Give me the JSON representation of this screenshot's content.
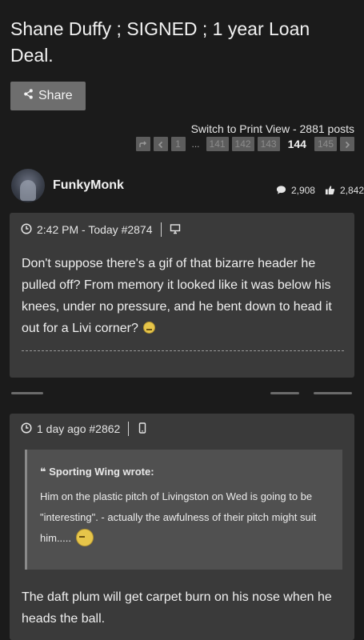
{
  "thread": {
    "title": "Shane Duffy ; SIGNED ; 1 year Loan Deal.",
    "share_label": "Share",
    "print_view": "Switch to Print View - 2881 posts"
  },
  "pagination": {
    "first": "1",
    "ellipsis": "...",
    "pages": [
      "141",
      "142",
      "143"
    ],
    "current": "144",
    "next_page": "145"
  },
  "post1": {
    "username": "FunkyMonk",
    "comments_count": "2,908",
    "likes_count": "2,842",
    "timestamp": "2:42 PM - Today #2874",
    "body": "Don't suppose there's a gif of that bizarre header he pulled off? From memory it looked like it was below his knees, under no pressure, and he bent down to head it out for a Livi corner?",
    "device_icon": "desktop-icon"
  },
  "post2": {
    "timestamp": "1 day ago #2862",
    "device_icon": "mobile-icon",
    "quote_author": "Sporting Wing wrote:",
    "quote_text": "Him on the plastic pitch of Livingston on Wed is going to be \"interesting\". - actually the awfulness of their pitch might suit him.....",
    "body": "The daft plum will get carpet burn on his nose when he heads the ball."
  },
  "colors": {
    "background": "#1b1b1b",
    "card": "#3a3a3a",
    "quote_bg": "#505050",
    "button": "#6e6e6e"
  }
}
